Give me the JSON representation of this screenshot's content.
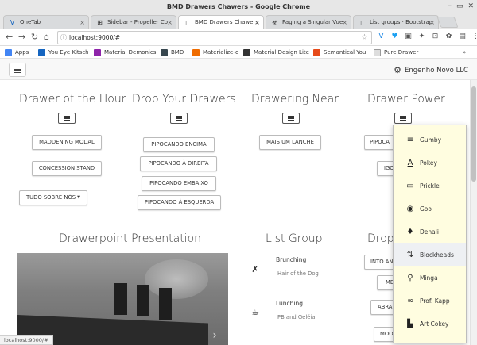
{
  "window": {
    "title": "BMD Drawers Chawers - Google Chrome"
  },
  "tabs": [
    {
      "label": "OneTab",
      "icon": "onetab-icon"
    },
    {
      "label": "Sidebar - Propeller Co",
      "icon": "propeller-icon"
    },
    {
      "label": "BMD Drawers Chawers",
      "icon": "page-icon",
      "active": true
    },
    {
      "label": "Paging a Singular Vue",
      "icon": "biohazard-icon"
    },
    {
      "label": "List groups · Bootstrap",
      "icon": "bootstrap-icon"
    }
  ],
  "toolbar": {
    "url": "localhost:9000/#"
  },
  "bookmarks": [
    {
      "label": "Apps",
      "color": "#4285f4"
    },
    {
      "label": "You Eye Kitsch",
      "color": "#1565c0"
    },
    {
      "label": "Material Demonics",
      "color": "#8e24aa"
    },
    {
      "label": "BMD",
      "color": "#37474f"
    },
    {
      "label": "Materialize-o",
      "color": "#ef6c00"
    },
    {
      "label": "Material Design Lite",
      "color": "#333333"
    },
    {
      "label": "Semantical You",
      "color": "#e64a19"
    },
    {
      "label": "Pure Drawer",
      "color": "#dddddd"
    }
  ],
  "appbar": {
    "brand": "Engenho Novo LLC"
  },
  "columns": {
    "c1": {
      "title": "Drawer of the Hour",
      "buttons": [
        "MADDENING MODAL",
        "CONCESSION STAND"
      ],
      "dropdown": "TUDO SOBRE NÓS"
    },
    "c2": {
      "title": "Drop Your Drawers",
      "buttons": [
        "PIPOCANDO ENCIMA",
        "PIPOCANDO À DIREITA",
        "PIPOCANDO EMBAIXO",
        "PIPOCANDO À ESQUERDA"
      ]
    },
    "c3": {
      "title": "Drawering Near",
      "buttons": [
        "MAIS UM LANCHE"
      ]
    },
    "c4": {
      "title": "Drawer Power",
      "buttons": [
        "PIPOCA",
        "IGO"
      ]
    }
  },
  "sections": {
    "presentation": "Drawerpoint Presentation",
    "list_group": "List Group",
    "drop": "Drop",
    "drop_buttons": [
      "INTO AN",
      "ME",
      "ABRA",
      "MOO"
    ]
  },
  "list_group": [
    {
      "icon": "cutlery-icon",
      "title": "Brunching",
      "sub": "Hair of the Dog"
    },
    {
      "icon": "coffee-icon",
      "title": "Lunching",
      "sub": "PB and Geléia"
    }
  ],
  "dropdown_menu": [
    {
      "label": "Gumby",
      "icon": "short-text-icon"
    },
    {
      "label": "Pokey",
      "icon": "text-format-icon"
    },
    {
      "label": "Prickle",
      "icon": "chat-bubble-icon"
    },
    {
      "label": "Goo",
      "icon": "eye-icon"
    },
    {
      "label": "Denali",
      "icon": "place-icon"
    },
    {
      "label": "Blockheads",
      "icon": "swap-vert-icon",
      "highlighted": true
    },
    {
      "label": "Minga",
      "icon": "run-icon"
    },
    {
      "label": "Prof. Kapp",
      "icon": "infinity-icon"
    },
    {
      "label": "Art Cokey",
      "icon": "book-icon"
    }
  ],
  "statusbar": "localhost:9000/#"
}
